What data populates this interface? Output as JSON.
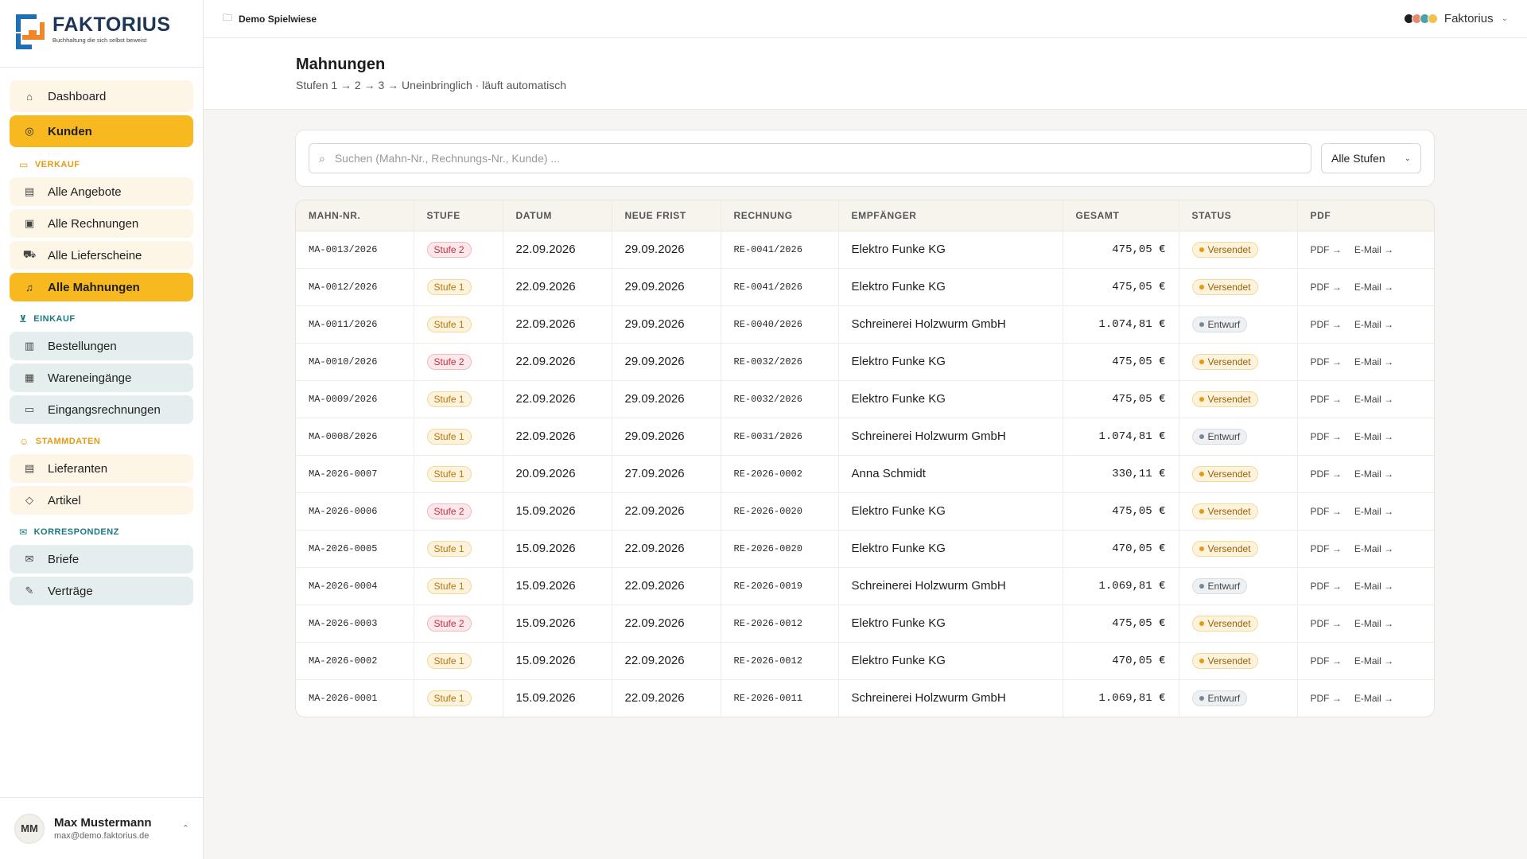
{
  "brand": {
    "name": "FAKTORIUS",
    "tagline": "Buchhaltung die sich selbst beweist"
  },
  "nav": {
    "top": [
      {
        "label": "Dashboard",
        "icon": "home-icon",
        "style": "warm"
      },
      {
        "label": "Kunden",
        "icon": "user-circle-icon",
        "style": "active"
      }
    ],
    "verkauf": {
      "title": "VERKAUF",
      "items": [
        {
          "label": "Alle Angebote",
          "icon": "document-icon",
          "style": "warm"
        },
        {
          "label": "Alle Rechnungen",
          "icon": "banknote-icon",
          "style": "warm"
        },
        {
          "label": "Alle Lieferscheine",
          "icon": "truck-icon",
          "style": "warm"
        },
        {
          "label": "Alle Mahnungen",
          "icon": "bell-icon",
          "style": "active"
        }
      ]
    },
    "einkauf": {
      "title": "EINKAUF",
      "items": [
        {
          "label": "Bestellungen",
          "icon": "clipboard-icon",
          "style": "cool"
        },
        {
          "label": "Wareneingänge",
          "icon": "box-icon",
          "style": "cool"
        },
        {
          "label": "Eingangsrechnungen",
          "icon": "inbox-icon",
          "style": "cool"
        }
      ]
    },
    "stammdaten": {
      "title": "STAMMDATEN",
      "items": [
        {
          "label": "Lieferanten",
          "icon": "building-icon",
          "style": "warm"
        },
        {
          "label": "Artikel",
          "icon": "tag-icon",
          "style": "warm"
        }
      ]
    },
    "korrespondenz": {
      "title": "KORRESPONDENZ",
      "items": [
        {
          "label": "Briefe",
          "icon": "mail-icon",
          "style": "cool"
        },
        {
          "label": "Verträge",
          "icon": "file-signature-icon",
          "style": "cool"
        }
      ]
    }
  },
  "user": {
    "initials": "MM",
    "name": "Max Mustermann",
    "email": "max@demo.faktorius.de"
  },
  "topbar": {
    "breadcrumb": "Demo Spielwiese",
    "org_name": "Faktorius",
    "org_colors": [
      "#1d1d1d",
      "#e88a6a",
      "#4aa3a8",
      "#f2c14e"
    ]
  },
  "page": {
    "title": "Mahnungen",
    "subtitle": "Stufen 1 → 2 → 3 → Uneinbringlich · läuft automatisch"
  },
  "search": {
    "placeholder": "Suchen (Mahn-Nr., Rechnungs-Nr., Kunde) ...",
    "value": "",
    "filter_selected": "Alle Stufen"
  },
  "table": {
    "columns": [
      "MAHN-NR.",
      "STUFE",
      "DATUM",
      "NEUE FRIST",
      "RECHNUNG",
      "EMPFÄNGER",
      "GESAMT",
      "STATUS",
      "PDF"
    ],
    "pdf_label": "PDF →",
    "email_label": "E-Mail →",
    "rows": [
      {
        "nr": "MA-0013/2026",
        "stufe": "Stufe 2",
        "level": 2,
        "datum": "22.09.2026",
        "frist": "29.09.2026",
        "rechnung": "RE-0041/2026",
        "empfaenger": "Elektro Funke KG",
        "gesamt": "475,05 €",
        "status": "Versendet",
        "state": "sent"
      },
      {
        "nr": "MA-0012/2026",
        "stufe": "Stufe 1",
        "level": 1,
        "datum": "22.09.2026",
        "frist": "29.09.2026",
        "rechnung": "RE-0041/2026",
        "empfaenger": "Elektro Funke KG",
        "gesamt": "475,05 €",
        "status": "Versendet",
        "state": "sent"
      },
      {
        "nr": "MA-0011/2026",
        "stufe": "Stufe 1",
        "level": 1,
        "datum": "22.09.2026",
        "frist": "29.09.2026",
        "rechnung": "RE-0040/2026",
        "empfaenger": "Schreinerei Holzwurm GmbH",
        "gesamt": "1.074,81 €",
        "status": "Entwurf",
        "state": "draft"
      },
      {
        "nr": "MA-0010/2026",
        "stufe": "Stufe 2",
        "level": 2,
        "datum": "22.09.2026",
        "frist": "29.09.2026",
        "rechnung": "RE-0032/2026",
        "empfaenger": "Elektro Funke KG",
        "gesamt": "475,05 €",
        "status": "Versendet",
        "state": "sent"
      },
      {
        "nr": "MA-0009/2026",
        "stufe": "Stufe 1",
        "level": 1,
        "datum": "22.09.2026",
        "frist": "29.09.2026",
        "rechnung": "RE-0032/2026",
        "empfaenger": "Elektro Funke KG",
        "gesamt": "475,05 €",
        "status": "Versendet",
        "state": "sent"
      },
      {
        "nr": "MA-0008/2026",
        "stufe": "Stufe 1",
        "level": 1,
        "datum": "22.09.2026",
        "frist": "29.09.2026",
        "rechnung": "RE-0031/2026",
        "empfaenger": "Schreinerei Holzwurm GmbH",
        "gesamt": "1.074,81 €",
        "status": "Entwurf",
        "state": "draft"
      },
      {
        "nr": "MA-2026-0007",
        "stufe": "Stufe 1",
        "level": 1,
        "datum": "20.09.2026",
        "frist": "27.09.2026",
        "rechnung": "RE-2026-0002",
        "empfaenger": "Anna Schmidt",
        "gesamt": "330,11 €",
        "status": "Versendet",
        "state": "sent"
      },
      {
        "nr": "MA-2026-0006",
        "stufe": "Stufe 2",
        "level": 2,
        "datum": "15.09.2026",
        "frist": "22.09.2026",
        "rechnung": "RE-2026-0020",
        "empfaenger": "Elektro Funke KG",
        "gesamt": "475,05 €",
        "status": "Versendet",
        "state": "sent"
      },
      {
        "nr": "MA-2026-0005",
        "stufe": "Stufe 1",
        "level": 1,
        "datum": "15.09.2026",
        "frist": "22.09.2026",
        "rechnung": "RE-2026-0020",
        "empfaenger": "Elektro Funke KG",
        "gesamt": "470,05 €",
        "status": "Versendet",
        "state": "sent"
      },
      {
        "nr": "MA-2026-0004",
        "stufe": "Stufe 1",
        "level": 1,
        "datum": "15.09.2026",
        "frist": "22.09.2026",
        "rechnung": "RE-2026-0019",
        "empfaenger": "Schreinerei Holzwurm GmbH",
        "gesamt": "1.069,81 €",
        "status": "Entwurf",
        "state": "draft"
      },
      {
        "nr": "MA-2026-0003",
        "stufe": "Stufe 2",
        "level": 2,
        "datum": "15.09.2026",
        "frist": "22.09.2026",
        "rechnung": "RE-2026-0012",
        "empfaenger": "Elektro Funke KG",
        "gesamt": "475,05 €",
        "status": "Versendet",
        "state": "sent"
      },
      {
        "nr": "MA-2026-0002",
        "stufe": "Stufe 1",
        "level": 1,
        "datum": "15.09.2026",
        "frist": "22.09.2026",
        "rechnung": "RE-2026-0012",
        "empfaenger": "Elektro Funke KG",
        "gesamt": "470,05 €",
        "status": "Versendet",
        "state": "sent"
      },
      {
        "nr": "MA-2026-0001",
        "stufe": "Stufe 1",
        "level": 1,
        "datum": "15.09.2026",
        "frist": "22.09.2026",
        "rechnung": "RE-2026-0011",
        "empfaenger": "Schreinerei Holzwurm GmbH",
        "gesamt": "1.069,81 €",
        "status": "Entwurf",
        "state": "draft"
      }
    ]
  }
}
